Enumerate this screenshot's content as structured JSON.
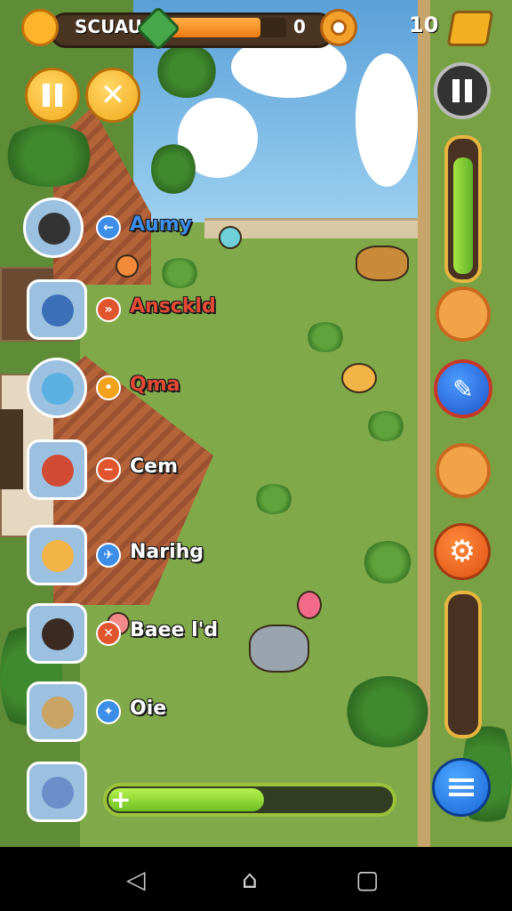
{
  "hud": {
    "title": "SCUAU",
    "progress_fraction": 0.78,
    "score": "0",
    "level": "10",
    "icons": [
      "sun-icon",
      "gem-icon",
      "coin-icon",
      "level-hat-icon"
    ]
  },
  "controls": {
    "pause_icon": "pause-icon",
    "close_icon": "close-icon"
  },
  "characters": [
    {
      "name": "Aumy",
      "color": "#3d8ee8",
      "badge_color": "#3d8ee8",
      "badge_glyph": "←",
      "avatar_color": "#333333"
    },
    {
      "name": "Ansckld",
      "color": "#e24a35",
      "badge_color": "#e0542e",
      "badge_glyph": "»",
      "avatar_color": "#3b6fb8"
    },
    {
      "name": "Qma",
      "color": "#e24a35",
      "badge_color": "#f2a21b",
      "badge_glyph": "•",
      "avatar_color": "#5ab0e0"
    },
    {
      "name": "Cem",
      "color": "#ffffff",
      "badge_color": "#e0542e",
      "badge_glyph": "−",
      "avatar_color": "#d04a34"
    },
    {
      "name": "Narihg",
      "color": "#ffffff",
      "badge_color": "#3d8ee8",
      "badge_glyph": "✈",
      "avatar_color": "#f2b347"
    },
    {
      "name": "Baee l'd",
      "color": "#ffffff",
      "badge_color": "#e0542e",
      "badge_glyph": "✕",
      "avatar_color": "#3a2a22"
    },
    {
      "name": "Oie",
      "color": "#ffffff",
      "badge_color": "#3d8ee8",
      "badge_glyph": "✦",
      "avatar_color": "#c9a464"
    },
    {
      "name": "",
      "color": "#ffffff",
      "badge_color": "",
      "badge_glyph": "",
      "avatar_color": "#6a8fc8"
    }
  ],
  "right_panel": {
    "top_meter_fraction": 0.92,
    "bottom_meter_fraction": 0.0,
    "buttons": [
      "pause-icon",
      "fox-badge-icon",
      "pencil-icon",
      "dog-badge-icon",
      "gear-icon",
      "menu-icon"
    ]
  },
  "bottom_bar": {
    "fill_fraction": 0.55,
    "plus_label": "+"
  },
  "system_nav": {
    "back": "◁",
    "home": "⌂",
    "recents": "▢"
  },
  "colors": {
    "grass": "#80aa49",
    "accent_orange": "#ee7a14",
    "accent_green": "#6fbf24"
  }
}
